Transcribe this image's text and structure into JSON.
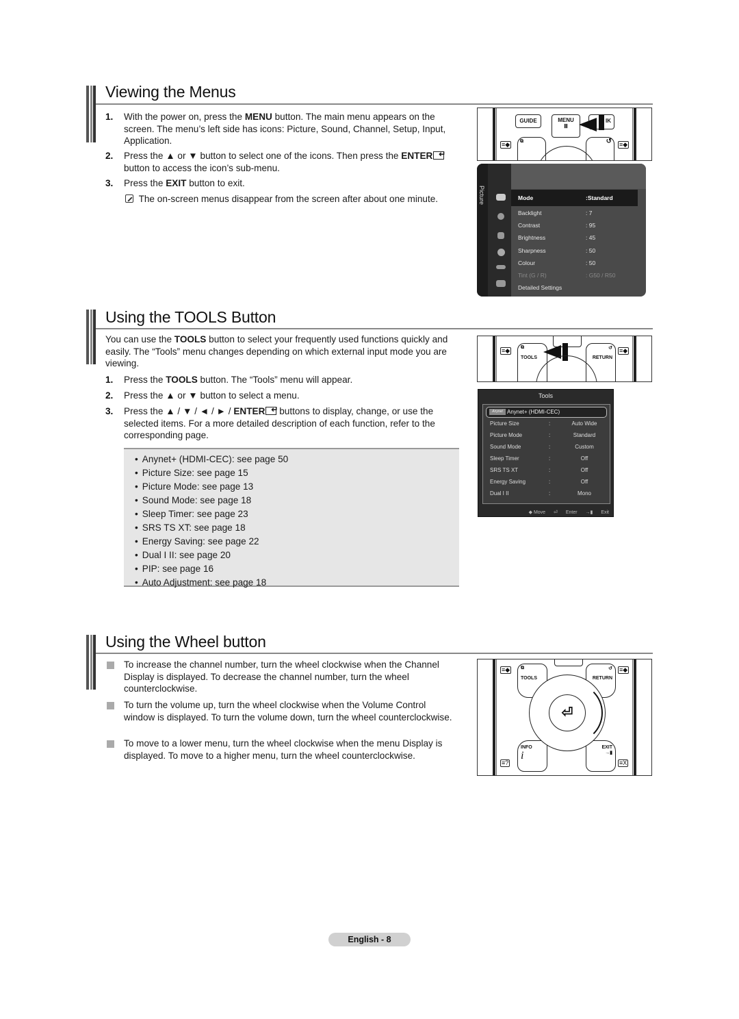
{
  "sections": {
    "menus": {
      "title": "Viewing the Menus",
      "steps": [
        {
          "num": "1.",
          "pre": "With the power on, press the ",
          "bold": "MENU",
          "post": " button. The main menu appears on the screen. The menu’s left side has icons: Picture, Sound, Channel, Setup, Input, Application."
        },
        {
          "num": "2.",
          "pre": "Press the ▲ or ▼ button to select one of the icons. Then press the ",
          "bold": "ENTER",
          "post": " button to access the icon’s sub-menu."
        },
        {
          "num": "3.",
          "pre": "Press the ",
          "bold": "EXIT",
          "post": " button to exit."
        }
      ],
      "note": "The on-screen menus disappear from the screen after about one minute."
    },
    "tools": {
      "title": "Using the TOOLS Button",
      "intro_pre": "You can use the ",
      "intro_bold": "TOOLS",
      "intro_post": " button to select your frequently used functions quickly and easily. The “Tools” menu changes depending on which external input mode you are viewing.",
      "steps": [
        {
          "num": "1.",
          "pre": "Press the ",
          "bold": "TOOLS",
          "post": " button. The “Tools” menu will appear."
        },
        {
          "num": "2.",
          "pre": "Press the ▲ or ▼ button to select a menu.",
          "bold": "",
          "post": ""
        },
        {
          "num": "3.",
          "pre": "Press the ▲ / ▼ / ◄ / ► / ",
          "bold": "ENTER",
          "post": " buttons to display, change, or use the selected items. For a more detailed description of each function, refer to the corresponding page."
        }
      ],
      "references": [
        "Anynet+ (HDMI-CEC): see page 50",
        "Picture Size: see page 15",
        "Picture Mode: see page 13",
        "Sound Mode: see page 18",
        "Sleep Timer: see page 23",
        "SRS TS XT: see page 18",
        "Energy Saving: see page 22",
        "Dual I II: see page 20",
        "PIP: see page 16",
        "Auto Adjustment: see page 18"
      ]
    },
    "wheel": {
      "title": "Using the Wheel button",
      "bullets": [
        "To increase the channel number, turn the wheel clockwise when the Channel Display is displayed. To decrease the channel number, turn the wheel counterclockwise.",
        "To turn the volume up, turn the wheel clockwise when the Volume Control window is displayed. To turn the volume down, turn the wheel counterclockwise.",
        "To move to a lower menu, turn the wheel clockwise when the menu Display is displayed. To move to a higher menu, turn the wheel counterclockwise."
      ]
    }
  },
  "remote": {
    "guide": "GUIDE",
    "menu": "MENU",
    "link": "IK",
    "tools": "TOOLS",
    "return": "RETURN",
    "info": "INFO",
    "exit": "EXIT"
  },
  "picture_menu": {
    "tab": "Picture",
    "rows": [
      {
        "label": "Mode",
        "value": ":Standard",
        "state": "selected"
      },
      {
        "label": "Backlight",
        "value": ": 7",
        "state": "normal"
      },
      {
        "label": "Contrast",
        "value": ": 95",
        "state": "normal"
      },
      {
        "label": "Brightness",
        "value": ": 45",
        "state": "normal"
      },
      {
        "label": "Sharpness",
        "value": ": 50",
        "state": "normal"
      },
      {
        "label": "Colour",
        "value": ": 50",
        "state": "normal"
      },
      {
        "label": "Tint (G / R)",
        "value": ": G50 / R50",
        "state": "disabled"
      },
      {
        "label": "Detailed Settings",
        "value": "",
        "state": "normal"
      }
    ]
  },
  "tools_menu": {
    "title": "Tools",
    "selected": "Anynet+ (HDMI-CEC)",
    "logo": "Anynet",
    "rows": [
      {
        "label": "Picture Size",
        "value": "Auto Wide"
      },
      {
        "label": "Picture Mode",
        "value": "Standard"
      },
      {
        "label": "Sound Mode",
        "value": "Custom"
      },
      {
        "label": "Sleep Timer",
        "value": "Off"
      },
      {
        "label": "SRS TS XT",
        "value": "Off"
      },
      {
        "label": "Energy Saving",
        "value": "Off"
      },
      {
        "label": "Dual I II",
        "value": "Mono"
      }
    ],
    "footer": {
      "move": "◆ Move",
      "enter": "Enter",
      "exit": "Exit"
    }
  },
  "footer": {
    "page": "English - 8"
  }
}
